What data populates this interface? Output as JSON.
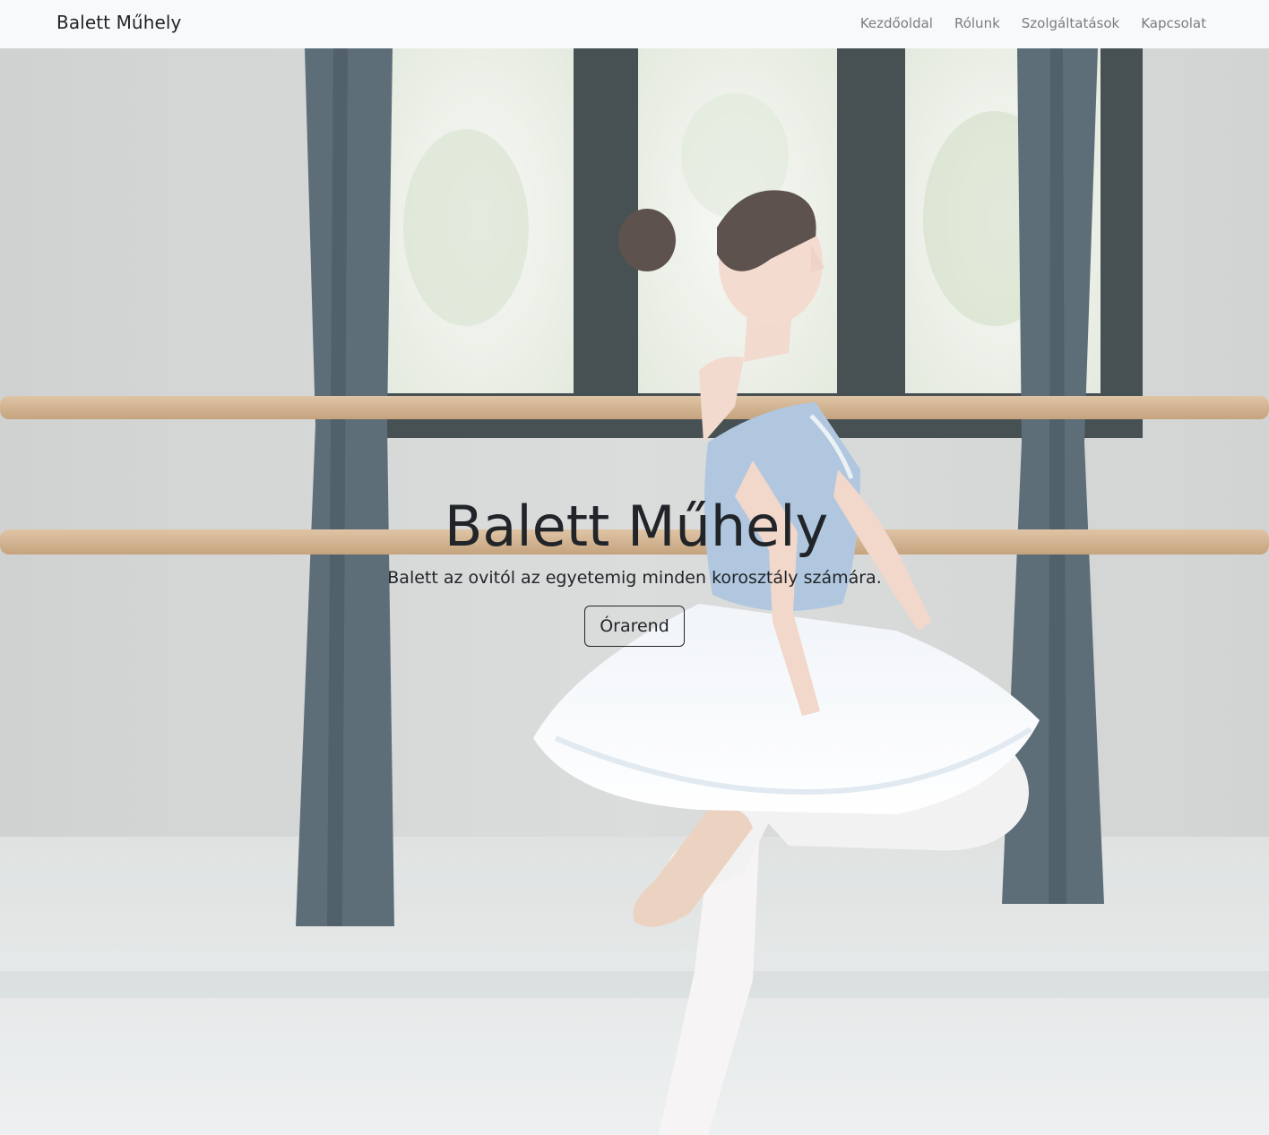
{
  "navbar": {
    "brand": "Balett Műhely",
    "links": [
      {
        "label": "Kezdőoldal"
      },
      {
        "label": "Rólunk"
      },
      {
        "label": "Szolgáltatások"
      },
      {
        "label": "Kapcsolat"
      }
    ]
  },
  "hero": {
    "title": "Balett Műhely",
    "subtitle": "Balett az ovitól az egyetemig minden korosztály számára.",
    "button_label": "Órarend",
    "background_image": "ballet-dancer-photo"
  },
  "colors": {
    "navbar_bg": "#f8f9fa",
    "text_dark": "#212529",
    "nav_link": "#7a7d80",
    "wall": "#c9cccb",
    "barre": "#c79f73",
    "curtain": "#334955",
    "tutu": "#9fbbd8"
  }
}
